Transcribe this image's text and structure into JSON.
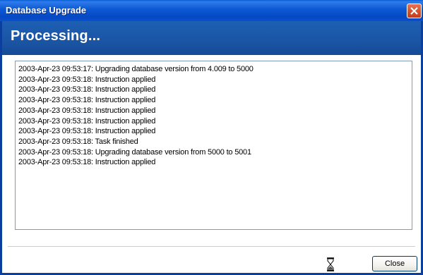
{
  "window": {
    "title": "Database Upgrade",
    "close_icon": "close-icon"
  },
  "header": {
    "title": "Processing..."
  },
  "log": {
    "lines": [
      "2003-Apr-23 09:53:17: Upgrading database version from 4.009 to 5000",
      "2003-Apr-23 09:53:18: Instruction applied",
      "2003-Apr-23 09:53:18: Instruction applied",
      "2003-Apr-23 09:53:18: Instruction applied",
      "2003-Apr-23 09:53:18: Instruction applied",
      "2003-Apr-23 09:53:18: Instruction applied",
      "2003-Apr-23 09:53:18: Instruction applied",
      "2003-Apr-23 09:53:18: Task finished",
      "2003-Apr-23 09:53:18: Upgrading database version from 5000 to 5001",
      "2003-Apr-23 09:53:18: Instruction applied"
    ]
  },
  "footer": {
    "busy_icon": "hourglass-icon",
    "close_label": "Close"
  },
  "colors": {
    "titlebar": "#0c58d3",
    "banner": "#1a55a5",
    "close_red": "#d9532f"
  }
}
